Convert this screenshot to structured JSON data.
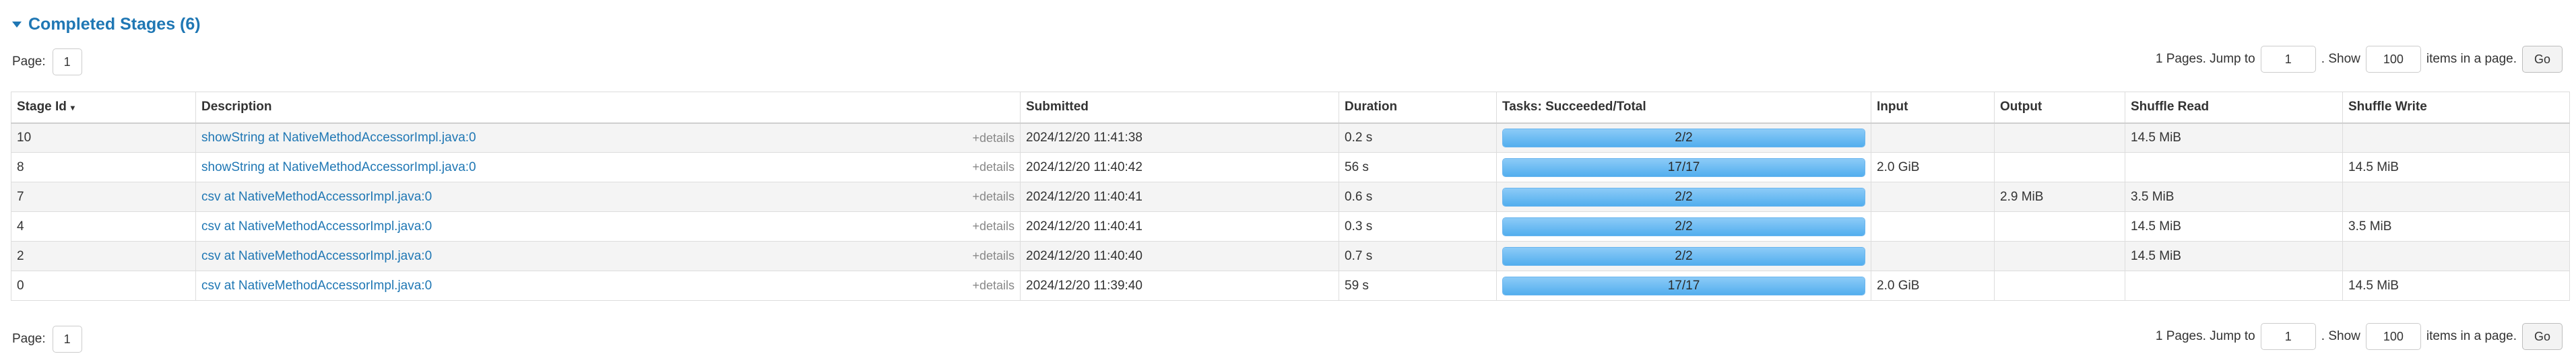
{
  "section": {
    "title": "Completed Stages (6)",
    "icon": "caret-down-icon"
  },
  "pager": {
    "page_label": "Page:",
    "current_page": "1",
    "pages_text": "1 Pages. Jump to",
    "jump_value": "1",
    "show_text": ". Show",
    "show_value": "100",
    "items_text": "items in a page.",
    "go_label": "Go"
  },
  "table": {
    "headers": {
      "stage_id": "Stage Id",
      "description": "Description",
      "submitted": "Submitted",
      "duration": "Duration",
      "tasks": "Tasks: Succeeded/Total",
      "input": "Input",
      "output": "Output",
      "shuffle_read": "Shuffle Read",
      "shuffle_write": "Shuffle Write"
    },
    "sort_indicator": "▾",
    "details_label": "+details",
    "rows": [
      {
        "id": "10",
        "desc": "showString at NativeMethodAccessorImpl.java:0",
        "submitted": "2024/12/20 11:41:38",
        "duration": "0.2 s",
        "tasks": "2/2",
        "progress": 1.0,
        "input": "",
        "output": "",
        "shuffle_read": "14.5 MiB",
        "shuffle_write": ""
      },
      {
        "id": "8",
        "desc": "showString at NativeMethodAccessorImpl.java:0",
        "submitted": "2024/12/20 11:40:42",
        "duration": "56 s",
        "tasks": "17/17",
        "progress": 1.0,
        "input": "2.0 GiB",
        "output": "",
        "shuffle_read": "",
        "shuffle_write": "14.5 MiB"
      },
      {
        "id": "7",
        "desc": "csv at NativeMethodAccessorImpl.java:0",
        "submitted": "2024/12/20 11:40:41",
        "duration": "0.6 s",
        "tasks": "2/2",
        "progress": 1.0,
        "input": "",
        "output": "2.9 MiB",
        "shuffle_read": "3.5 MiB",
        "shuffle_write": ""
      },
      {
        "id": "4",
        "desc": "csv at NativeMethodAccessorImpl.java:0",
        "submitted": "2024/12/20 11:40:41",
        "duration": "0.3 s",
        "tasks": "2/2",
        "progress": 1.0,
        "input": "",
        "output": "",
        "shuffle_read": "14.5 MiB",
        "shuffle_write": "3.5 MiB"
      },
      {
        "id": "2",
        "desc": "csv at NativeMethodAccessorImpl.java:0",
        "submitted": "2024/12/20 11:40:40",
        "duration": "0.7 s",
        "tasks": "2/2",
        "progress": 1.0,
        "input": "",
        "output": "",
        "shuffle_read": "14.5 MiB",
        "shuffle_write": ""
      },
      {
        "id": "0",
        "desc": "csv at NativeMethodAccessorImpl.java:0",
        "submitted": "2024/12/20 11:39:40",
        "duration": "59 s",
        "tasks": "17/17",
        "progress": 1.0,
        "input": "2.0 GiB",
        "output": "",
        "shuffle_read": "",
        "shuffle_write": "14.5 MiB"
      }
    ]
  },
  "colors": {
    "link": "#1f77b4",
    "bar": "#52aeee"
  }
}
